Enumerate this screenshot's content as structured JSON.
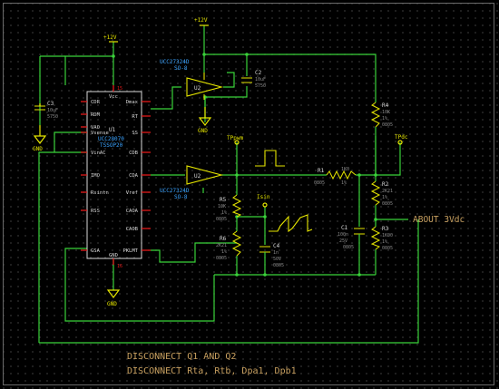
{
  "supply_labels": [
    "+12V",
    "+12V"
  ],
  "ground_label": "GND",
  "u1": {
    "ref": "U1",
    "part": "UCC28070",
    "package": "TSSOP20",
    "pins_left": [
      "CDR",
      "RDM",
      "VAO",
      "Vsense",
      "VinAC",
      "IMO",
      "Rsintn",
      "RSS",
      "GSA"
    ],
    "pins_right": [
      "Vcc",
      "Dmax",
      "RT",
      "SS",
      "CDB",
      "CDA",
      "Vref",
      "CAOA",
      "CAOB",
      "PKLMT"
    ],
    "pin_gnd": "GND",
    "pin_vcc_num": "15",
    "pin_gnd_num": "16"
  },
  "u2_top": {
    "ref": "U2",
    "part": "UCC27324D",
    "package": "SO-8"
  },
  "u2_bottom": {
    "ref": "U2",
    "part": "UCC27324D",
    "package": "SO-8"
  },
  "components": {
    "C3": {
      "ref": "C3",
      "value": "10uF",
      "size": "5750"
    },
    "C2": {
      "ref": "C2",
      "value": "10uF",
      "size": "5750"
    },
    "R4": {
      "ref": "R4",
      "value": "10K",
      "tol": "1%",
      "size": "0805"
    },
    "R1": {
      "ref": "R1",
      "value": "1K0",
      "tol": "1%",
      "size": "0805"
    },
    "R2": {
      "ref": "R2",
      "value": "2K21",
      "tol": "1%",
      "size": "0805"
    },
    "R3": {
      "ref": "R3",
      "value": "1K00",
      "tol": "1%",
      "size": "0805"
    },
    "C1": {
      "ref": "C1",
      "value": "100n",
      "voltage": "25V",
      "size": "0805"
    },
    "R5": {
      "ref": "R5",
      "value": "10K",
      "tol": "1%",
      "size": "0805"
    },
    "R6": {
      "ref": "R6",
      "value": "2K21",
      "tol": "1%",
      "size": "0805"
    },
    "C4": {
      "ref": "C4",
      "value": "1n",
      "voltage": "50V",
      "size": "0805"
    }
  },
  "test_points": {
    "pwm": "TPpwm",
    "dc": "TPdc",
    "isin": "Isin"
  },
  "about_label": "ABOUT 3Vdc",
  "notes": [
    "DISCONNECT Q1 AND Q2",
    "DISCONNECT Rta, Rtb, Dpa1, Dpb1"
  ]
}
